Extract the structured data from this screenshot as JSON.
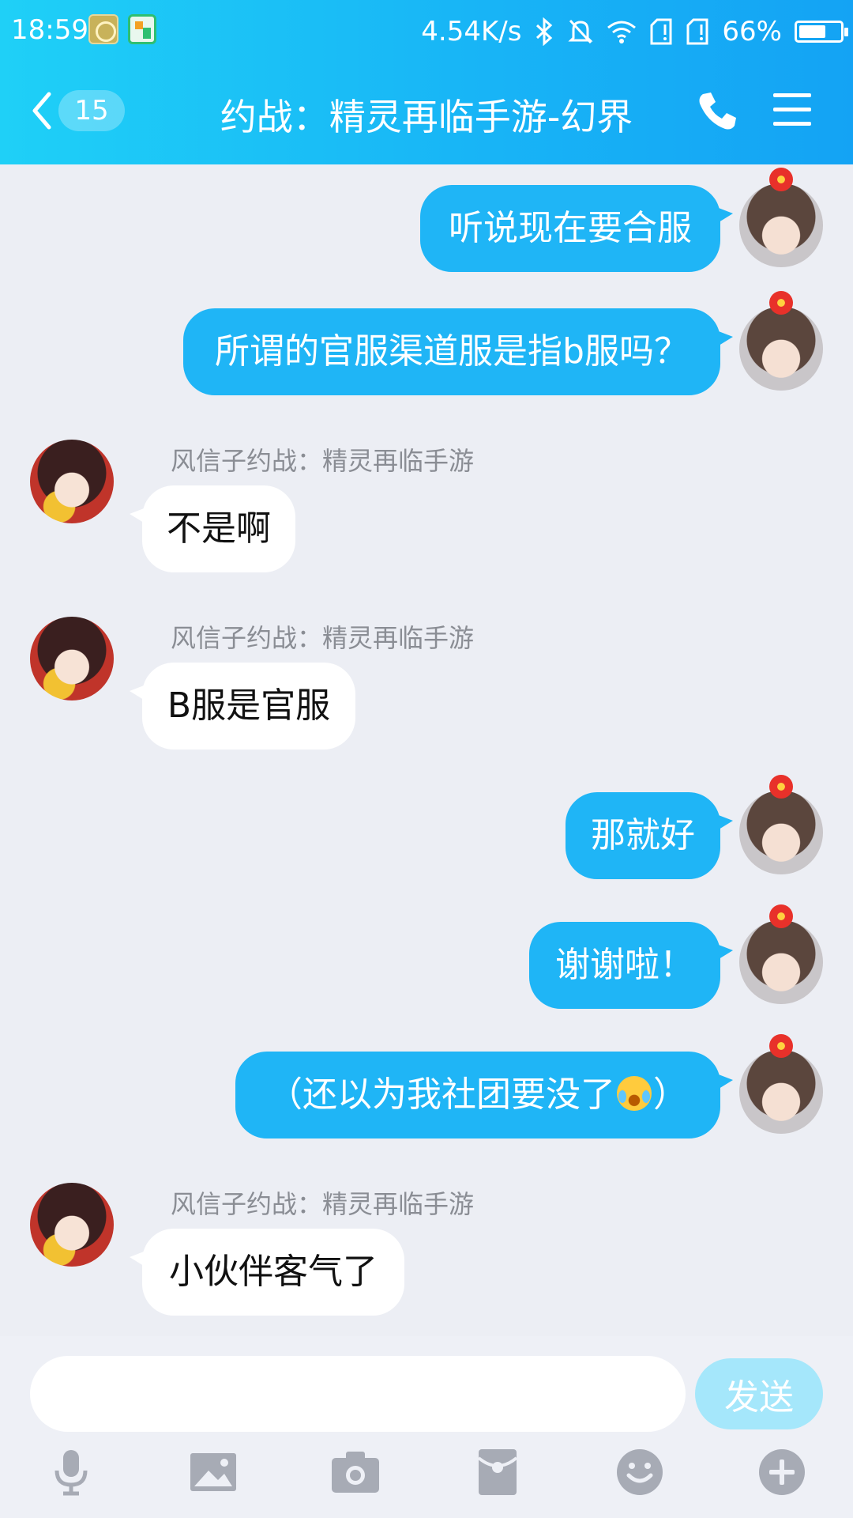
{
  "status_bar": {
    "time": "18:59",
    "net_speed": "4.54K/s",
    "battery_percent": "66%",
    "battery_level": 0.66
  },
  "header": {
    "unread_badge": "15",
    "title": "约战：精灵再临手游-幻界"
  },
  "messages": [
    {
      "from": "me",
      "text": "听说现在要合服"
    },
    {
      "from": "me",
      "text": "所谓的官服渠道服是指b服吗？"
    },
    {
      "from": "other",
      "sender": "风信子约战：精灵再临手游",
      "text": "不是啊"
    },
    {
      "from": "other",
      "sender": "风信子约战：精灵再临手游",
      "text": "B服是官服"
    },
    {
      "from": "me",
      "text": "那就好"
    },
    {
      "from": "me",
      "text": "谢谢啦！"
    },
    {
      "from": "me",
      "text_before": "（还以为我社团要没了",
      "emoji": "tears-of-joy-emoji",
      "text_after": "）"
    },
    {
      "from": "other",
      "sender": "风信子约战：精灵再临手游",
      "text": "小伙伴客气了"
    }
  ],
  "composer": {
    "input_value": "",
    "send_label": "发送"
  },
  "toolbar_icons": [
    "microphone-icon",
    "image-icon",
    "camera-icon",
    "red-packet-icon",
    "emoji-icon",
    "plus-icon"
  ],
  "colors": {
    "header_gradient_start": "#1fd0f7",
    "header_gradient_end": "#14a3f4",
    "my_bubble": "#1fb5f6",
    "other_bubble": "#ffffff",
    "chat_background": "#eceef4",
    "send_button_disabled": "#a5e7fb",
    "toolbar_icon": "#a7abb5"
  }
}
